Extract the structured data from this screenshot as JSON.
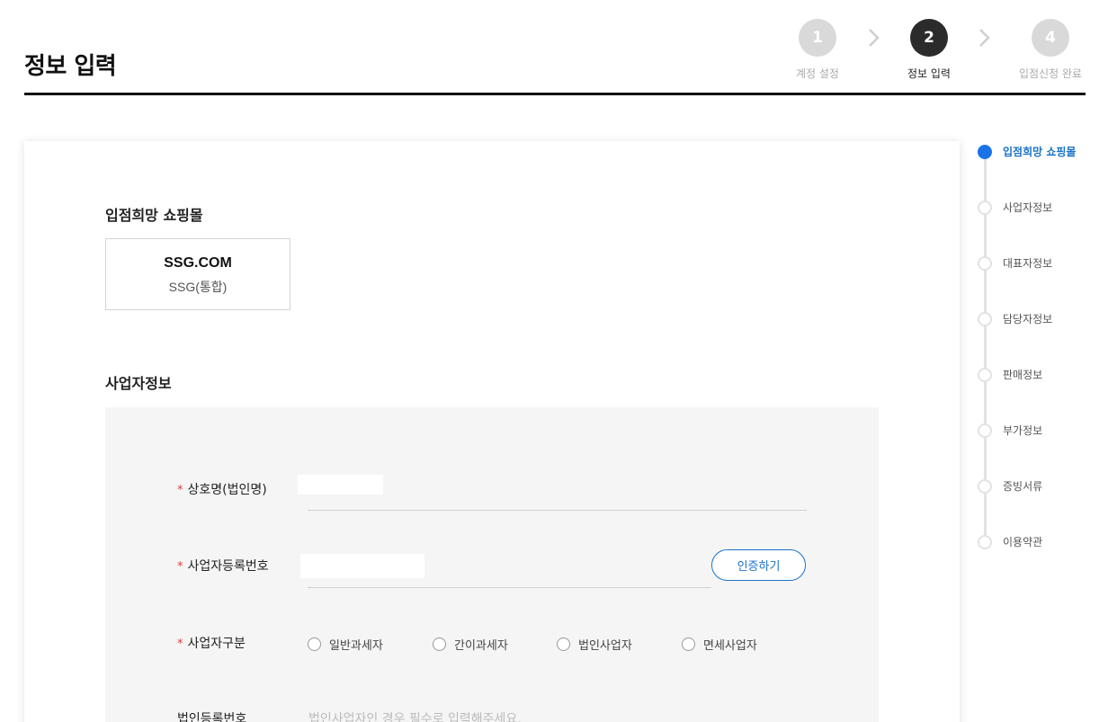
{
  "page": {
    "title": "정보 입력"
  },
  "steps": [
    {
      "number": "1",
      "label": "계정 설정"
    },
    {
      "number": "2",
      "label": "정보 입력"
    },
    {
      "number": "4",
      "label": "입점신청 완료"
    }
  ],
  "mall_section": {
    "title": "입점희망 쇼핑몰",
    "mall_name": "SSG.COM",
    "mall_sub": "SSG(통합)"
  },
  "business_section": {
    "title": "사업자정보",
    "company_name_label": "상호명(법인명)",
    "biz_number_label": "사업자등록번호",
    "verify_button": "인증하기",
    "biz_type_label": "사업자구분",
    "biz_type_options": [
      "일반과세자",
      "간이과세자",
      "법인사업자",
      "면세사업자"
    ],
    "corp_number_label": "법인등록번호",
    "corp_number_placeholder": "법인사업자인 경우 필수로 입력해주세요.",
    "required_mark": "*"
  },
  "side_nav": {
    "items": [
      "입점희망 쇼핑몰",
      "사업자정보",
      "대표자정보",
      "담당자정보",
      "판매정보",
      "부가정보",
      "증빙서류",
      "이용약관"
    ],
    "active_index": 0
  },
  "colors": {
    "accent": "#1a73e8",
    "required": "#e03a3a",
    "active_step": "#2b2b2b"
  }
}
